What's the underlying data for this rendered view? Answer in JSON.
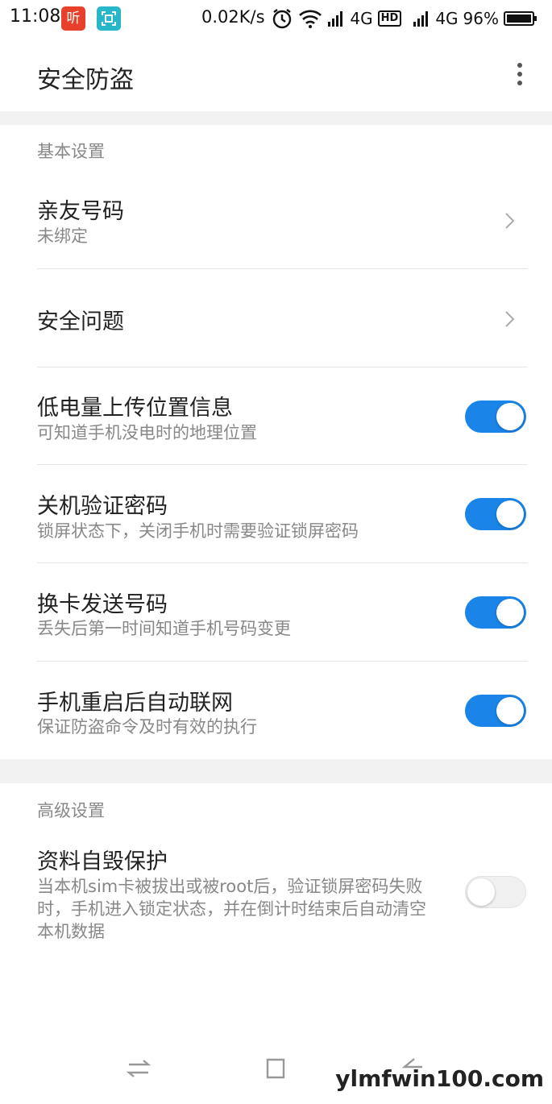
{
  "status_bar": {
    "time": "11:08",
    "app_badge": "听",
    "speed": "0.02K/s",
    "sim1_network": "4G",
    "hd_label": "HD",
    "sim2_network": "4G",
    "battery": "96%"
  },
  "app_bar": {
    "title": "安全防盗"
  },
  "sections": [
    {
      "header": "基本设置",
      "items": [
        {
          "title": "亲友号码",
          "subtitle": "未绑定",
          "control": "chevron"
        },
        {
          "title": "安全问题",
          "subtitle": "",
          "control": "chevron"
        },
        {
          "title": "低电量上传位置信息",
          "subtitle": "可知道手机没电时的地理位置",
          "control": "toggle",
          "on": true
        },
        {
          "title": "关机验证密码",
          "subtitle": "锁屏状态下，关闭手机时需要验证锁屏密码",
          "control": "toggle",
          "on": true
        },
        {
          "title": "换卡发送号码",
          "subtitle": "丢失后第一时间知道手机号码变更",
          "control": "toggle",
          "on": true
        },
        {
          "title": "手机重启后自动联网",
          "subtitle": "保证防盗命令及时有效的执行",
          "control": "toggle",
          "on": true
        }
      ]
    },
    {
      "header": "高级设置",
      "items": [
        {
          "title": "资料自毁保护",
          "subtitle_lines": [
            "当本机sim卡被拔出或被root后，验证锁屏密码失败",
            "时，手机进入锁定状态，并在倒计时结束后自动清空",
            "本机数据"
          ],
          "control": "toggle",
          "on": false
        }
      ]
    }
  ],
  "watermark": "ylmfwin100.com",
  "colors": {
    "accent": "#1a84e8",
    "band": "#f2f2f2",
    "secondary_text": "#888888"
  }
}
